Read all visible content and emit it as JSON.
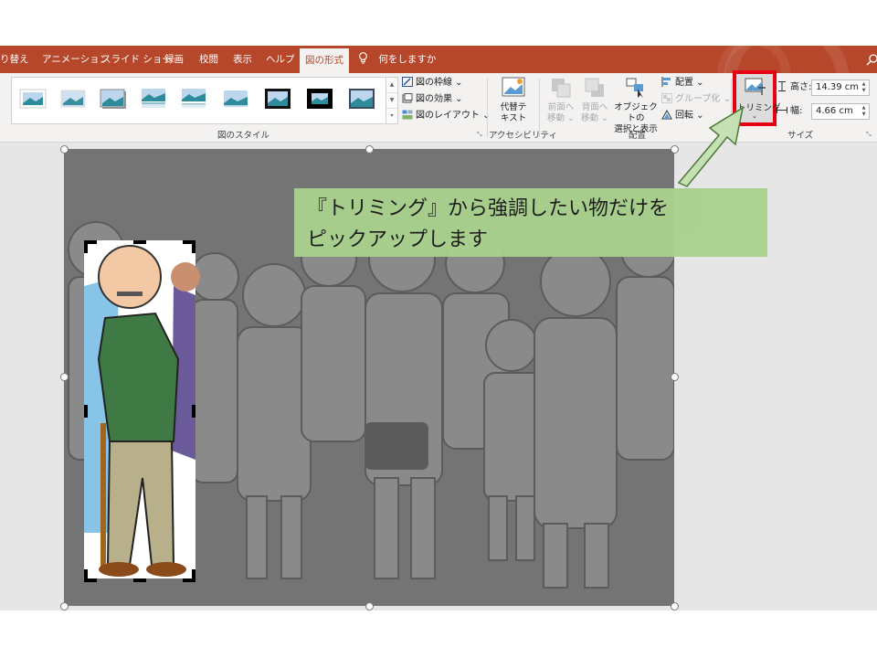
{
  "tabs": [
    "り替え",
    "アニメーション",
    "スライド ショー",
    "録画",
    "校閲",
    "表示",
    "ヘルプ",
    "図の形式"
  ],
  "tell_me": "何をしますか",
  "ribbon": {
    "picture_styles_group": "図のスタイル",
    "border": "図の枠線",
    "effects": "図の効果",
    "layout": "図のレイアウト",
    "alt_text": [
      "代替テ",
      "キスト"
    ],
    "accessibility_group": "アクセシビリティ",
    "bring_forward": [
      "前面へ",
      "移動"
    ],
    "send_backward": [
      "背面へ",
      "移動"
    ],
    "selection_pane": [
      "オブジェクトの",
      "選択と表示"
    ],
    "align": "配置",
    "group": "グループ化",
    "rotate": "回転",
    "arrange_group": "配置",
    "crop": "トリミング",
    "height_label": "高さ:",
    "height_value": "14.39 cm",
    "width_label": "幅:",
    "width_value": "4.66 cm",
    "size_group": "サイズ"
  },
  "callout": {
    "line1": "『トリミング』から強調したい物だけを",
    "line2": "ピックアップします"
  },
  "colors": {
    "accent": "#b7472a",
    "callout_bg": "#a9d18e",
    "highlight": "#e60012"
  }
}
